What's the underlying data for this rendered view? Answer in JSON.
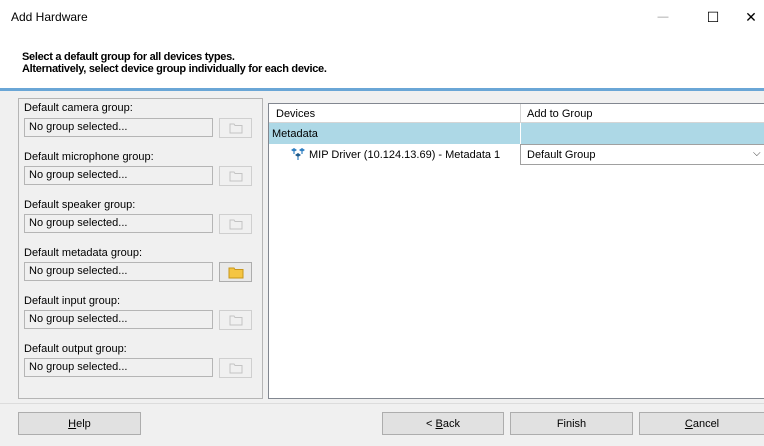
{
  "window": {
    "title": "Add Hardware",
    "minimize_glyph": "—",
    "maximize_glyph": "☐",
    "close_glyph": "✕"
  },
  "header": {
    "line1": "Select a default group for all devices types.",
    "line2": "Alternatively, select device group individually for each device."
  },
  "default_groups": [
    {
      "label": "Default camera group:",
      "value": "No group selected...",
      "button_enabled": false,
      "icon": "folder-icon"
    },
    {
      "label": "Default microphone group:",
      "value": "No group selected...",
      "button_enabled": false,
      "icon": "folder-icon"
    },
    {
      "label": "Default speaker group:",
      "value": "No group selected...",
      "button_enabled": false,
      "icon": "folder-icon"
    },
    {
      "label": "Default metadata group:",
      "value": "No group selected...",
      "button_enabled": true,
      "icon": "folder-icon"
    },
    {
      "label": "Default input group:",
      "value": "No group selected...",
      "button_enabled": false,
      "icon": "folder-icon"
    },
    {
      "label": "Default output group:",
      "value": "No group selected...",
      "button_enabled": false,
      "icon": "folder-icon"
    }
  ],
  "grid": {
    "columns": [
      "Devices",
      "Add to Group"
    ],
    "category": "Metadata",
    "rows": [
      {
        "device": "MIP Driver (10.124.13.69) - Metadata 1",
        "group": "Default Group",
        "icon": "metadata-device-icon"
      }
    ]
  },
  "buttons": {
    "help": {
      "mnemonic": "H",
      "rest": "elp"
    },
    "back": {
      "prefix": "< ",
      "mnemonic": "B",
      "rest": "ack"
    },
    "finish": "Finish",
    "cancel": {
      "mnemonic": "C",
      "rest": "ancel"
    }
  },
  "colors": {
    "accent_line": "#6aa6d6",
    "category_row": "#add8e6",
    "folder_enabled": "#f5c542"
  }
}
